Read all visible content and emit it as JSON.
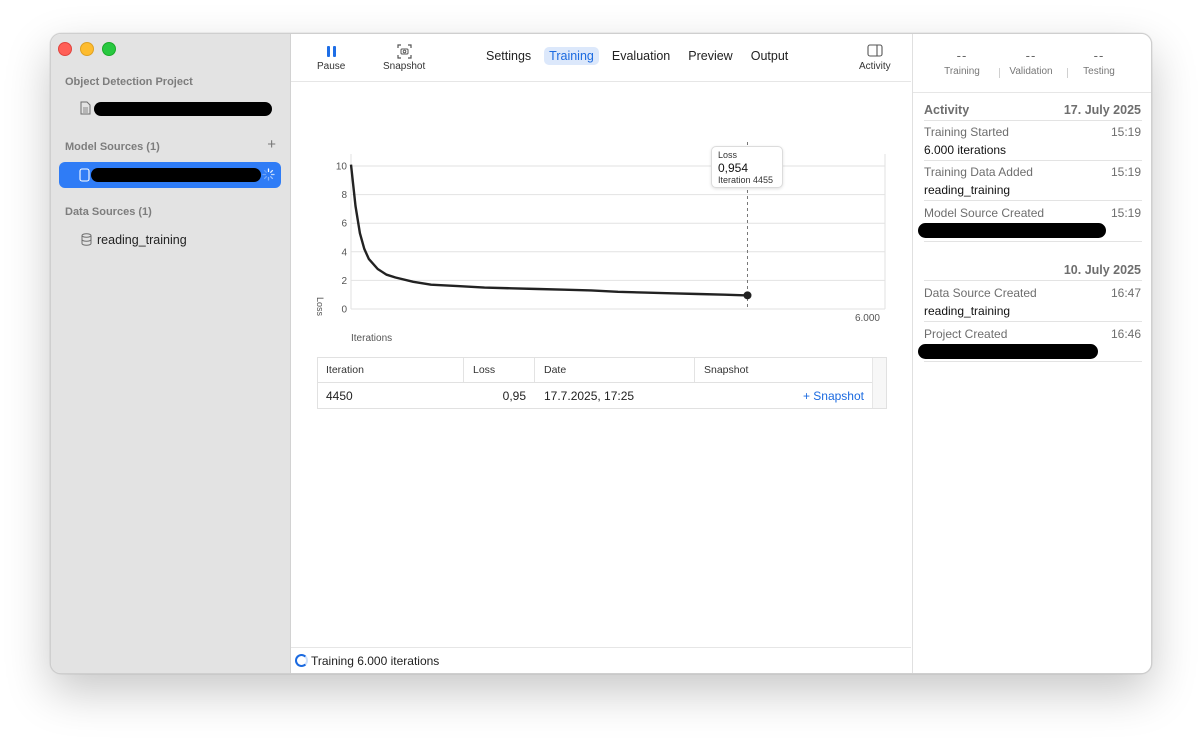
{
  "sidebar": {
    "project_header": "Object Detection Project",
    "model_sources_header": "Model Sources (1)",
    "add_symbol": "+",
    "data_sources_header": "Data Sources (1)",
    "data_source_item": "reading_training"
  },
  "toolbar": {
    "pause_label": "Pause",
    "snapshot_label": "Snapshot",
    "activity_label": "Activity",
    "tabs": [
      "Settings",
      "Training",
      "Evaluation",
      "Preview",
      "Output"
    ],
    "active_tab": "Training"
  },
  "chart_data": {
    "type": "line",
    "ylabel": "Loss",
    "xlabel": "Iterations",
    "x_tick_label": "6.000",
    "y_ticks": [
      0,
      2,
      4,
      6,
      8,
      10
    ],
    "xlim": [
      0,
      6000
    ],
    "ylim": [
      0,
      10
    ],
    "grid": true,
    "series": [
      {
        "x": [
          0,
          50,
          100,
          150,
          200,
          300,
          400,
          500,
          700,
          900,
          1200,
          1500,
          1800,
          2100,
          2400,
          2700,
          3000,
          3300,
          3600,
          3900,
          4200,
          4455
        ],
        "y": [
          10.1,
          7.2,
          5.3,
          4.2,
          3.5,
          2.8,
          2.4,
          2.2,
          1.9,
          1.7,
          1.6,
          1.5,
          1.45,
          1.4,
          1.35,
          1.3,
          1.2,
          1.15,
          1.1,
          1.05,
          1.0,
          0.954
        ]
      }
    ],
    "marker": {
      "x": 4455,
      "y": 0.954
    },
    "tooltip": {
      "title": "Loss",
      "value": "0,954",
      "iteration": "Iteration 4455"
    }
  },
  "table": {
    "headers": [
      "Iteration",
      "Loss",
      "Date",
      "Snapshot"
    ],
    "rows": [
      {
        "iteration": "4450",
        "loss": "0,95",
        "date": "17.7.2025, 17:25",
        "action": "+ Snapshot"
      }
    ]
  },
  "status": {
    "text": "Training 6.000 iterations"
  },
  "metrics": [
    {
      "value": "--",
      "label": "Training"
    },
    {
      "value": "--",
      "label": "Validation"
    },
    {
      "value": "--",
      "label": "Testing"
    }
  ],
  "activity": {
    "title": "Activity",
    "groups": [
      {
        "date": "17. July 2025",
        "events": [
          {
            "title": "Training Started",
            "time": "15:19",
            "detail": "6.000 iterations"
          },
          {
            "title": "Training Data Added",
            "time": "15:19",
            "detail": "reading_training"
          },
          {
            "title": "Model Source Created",
            "time": "15:19",
            "detail": ""
          }
        ]
      },
      {
        "date": "10. July 2025",
        "events": [
          {
            "title": "Data Source Created",
            "time": "16:47",
            "detail": "reading_training"
          },
          {
            "title": "Project Created",
            "time": "16:46",
            "detail": ""
          }
        ]
      }
    ]
  },
  "colors": {
    "accent": "#1b6ae0",
    "selection": "#2f7cf6",
    "sidebar_bg": "#e3e3e3",
    "line": "#222222"
  }
}
